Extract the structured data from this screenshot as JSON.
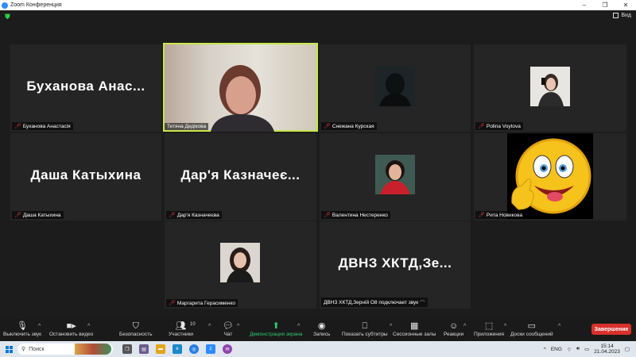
{
  "window": {
    "title": "Zoom Конференция",
    "controls": [
      "–",
      "❐",
      "✕"
    ]
  },
  "view_label": "Вид",
  "tiles": [
    {
      "big": "Буханова  Анас...",
      "name": "Буханова Анастасія"
    },
    {
      "big": "",
      "name": "Тетяна Дедікова"
    },
    {
      "big": "",
      "name": "Снежана Курская"
    },
    {
      "big": "",
      "name": "Polina Voytova"
    },
    {
      "big": "Даша Катыхина",
      "name": "Даша Катыхина"
    },
    {
      "big": "Дар'я  Казначеє...",
      "name": "Дар'я Казначеєва"
    },
    {
      "big": "",
      "name": "Валентина Нестеренко"
    },
    {
      "big": "",
      "name": "Рита Новикова"
    },
    {
      "big": "",
      "name": "Маргарита Герасименко"
    },
    {
      "big": "ДВНЗ  ХКТД,Зе...",
      "name": "ДВНЗ ХКТД,Зерній О8 подключает звук"
    }
  ],
  "toolbar": {
    "mute": "Выключить звук",
    "video": "Остановить видео",
    "security": "Безопасность",
    "participants": "Участники",
    "participants_count": "10",
    "chat": "Чат",
    "share": "Демонстрация экрана",
    "record": "Запись",
    "subtitles": "Показать субтитры",
    "breakout": "Сессионные залы",
    "reactions": "Реакции",
    "apps": "Приложения",
    "whiteboard": "Доски сообщений",
    "end": "Завершение"
  },
  "taskbar": {
    "search_placeholder": "Поиск",
    "lang": "ENG",
    "time": "15:14",
    "date": "21.04.2023"
  },
  "colors": {
    "active_border": "#c8e64a",
    "end": "#d9302c",
    "share": "#2ecc71",
    "mute_icon": "#e0393e"
  }
}
